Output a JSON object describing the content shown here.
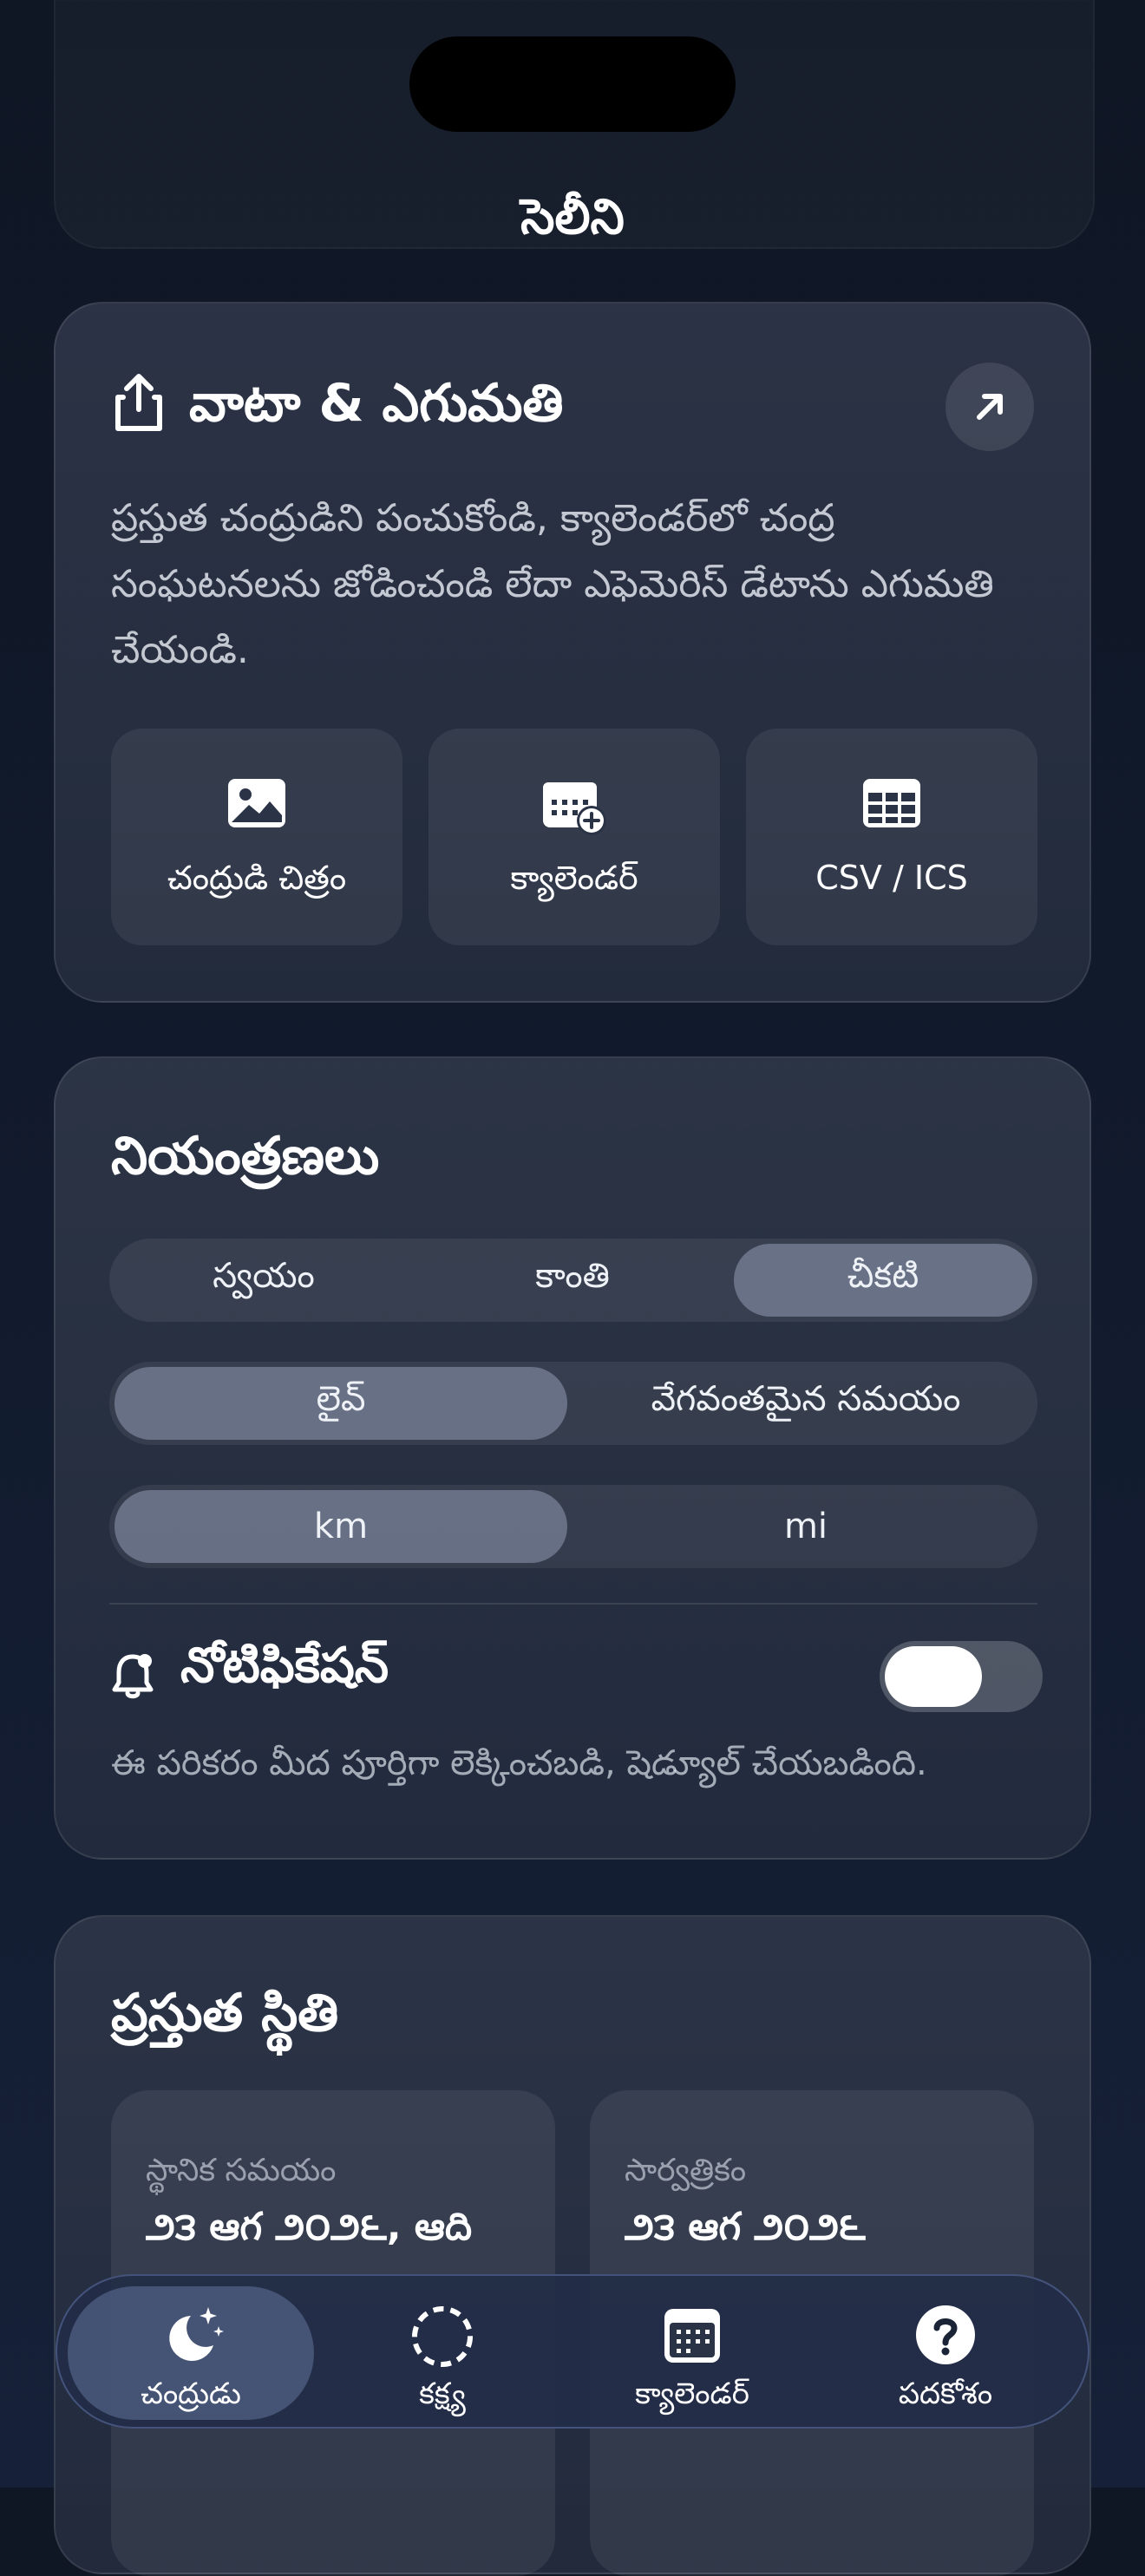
{
  "app": {
    "title": "సెలీని"
  },
  "export_card": {
    "title": "వాటా & ఎగుమతి",
    "description": "ప్రస్తుత చంద్రుడిని పంచుకోండి, క్యాలెండర్‌లో చంద్ర సంఘటనలను జోడించండి లేదా ఎఫెమెరిస్ డేటాను ఎగుమతి చేయండి.",
    "tiles": [
      {
        "label": "చంద్రుడి చిత్రం",
        "icon": "image-icon"
      },
      {
        "label": "క్యాలెండర్",
        "icon": "calendar-add-icon"
      },
      {
        "label": "CSV / ICS",
        "icon": "table-icon"
      }
    ]
  },
  "controls_card": {
    "title": "నియంత్రణలు",
    "theme_options": [
      "స్వయం",
      "కాంతి",
      "చీకటి"
    ],
    "theme_selected": "చీకటి",
    "time_options": [
      "లైవ్",
      "వేగవంతమైన సమయం"
    ],
    "time_selected": "లైవ్",
    "unit_options": [
      "km",
      "mi"
    ],
    "unit_selected": "km",
    "notifications": {
      "title": "నోటిఫికేషన్",
      "description": "ఈ పరికరం మీద పూర్తిగా లెక్కించబడి, షెడ్యూల్ చేయబడింది.",
      "enabled": false
    }
  },
  "status_card": {
    "title": "ప్రస్తుత స్థితి",
    "local": {
      "label": "స్థానిక సమయం",
      "value": "౨౩ ఆగ ౨౦౨౬, ఆది"
    },
    "universal": {
      "label": "సార్వత్రికం",
      "value": "౨౩ ఆగ ౨౦౨౬"
    }
  },
  "tabbar": {
    "items": [
      {
        "label": "చంద్రుడు",
        "icon": "moon-stars-icon",
        "active": true
      },
      {
        "label": "కక్ష్య",
        "icon": "orbit-icon",
        "active": false
      },
      {
        "label": "క్యాలెండర్",
        "icon": "calendar-icon",
        "active": false
      },
      {
        "label": "పదకోశం",
        "icon": "help-icon",
        "active": false
      }
    ]
  }
}
